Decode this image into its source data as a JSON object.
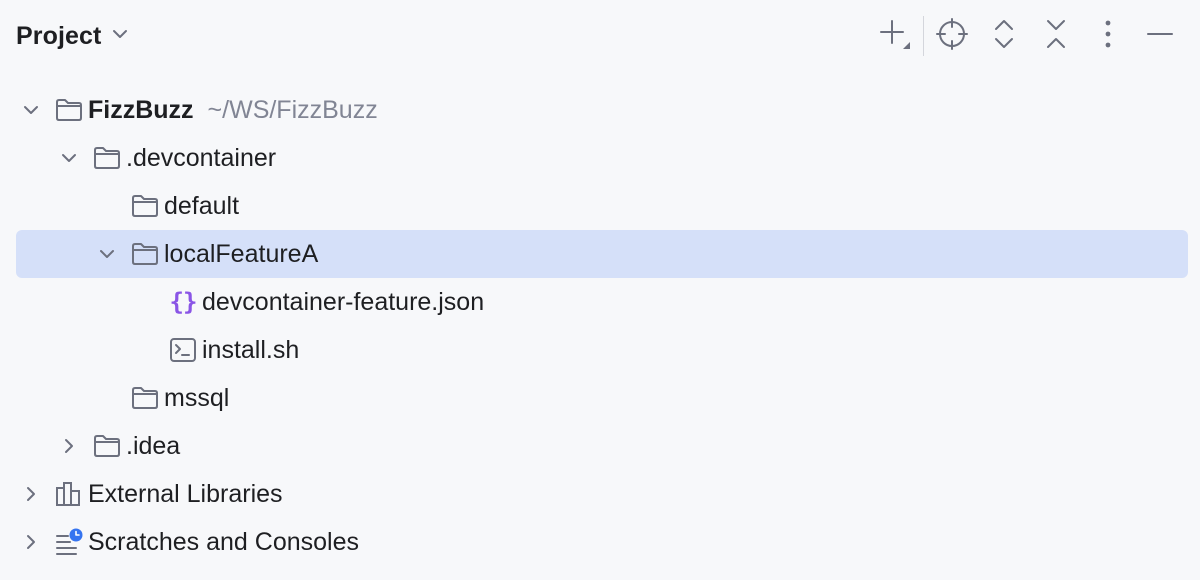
{
  "panel": {
    "title": "Project"
  },
  "toolbar": {
    "buttons": [
      {
        "name": "new-button",
        "icon": "plus-icon"
      },
      {
        "name": "locate-button",
        "icon": "crosshair-icon"
      },
      {
        "name": "expand-all-button",
        "icon": "expand-icon"
      },
      {
        "name": "collapse-all-button",
        "icon": "collapse-icon"
      },
      {
        "name": "options-button",
        "icon": "kebab-icon"
      },
      {
        "name": "hide-button",
        "icon": "minimize-icon"
      }
    ]
  },
  "tree": {
    "root": {
      "label": "FizzBuzz",
      "path": "~/WS/FizzBuzz",
      "expanded": true
    },
    "devcontainer": {
      "label": ".devcontainer",
      "expanded": true
    },
    "default": {
      "label": "default"
    },
    "localFeatureA": {
      "label": "localFeatureA",
      "expanded": true,
      "selected": true
    },
    "feature_json": {
      "label": "devcontainer-feature.json",
      "icon": "json-icon",
      "glyph": "{}"
    },
    "install_sh": {
      "label": "install.sh",
      "icon": "terminal-file-icon"
    },
    "mssql": {
      "label": "mssql"
    },
    "idea": {
      "label": ".idea",
      "expanded": false
    },
    "external_libraries": {
      "label": "External Libraries",
      "expanded": false,
      "icon": "library-icon"
    },
    "scratches": {
      "label": "Scratches and Consoles",
      "expanded": false,
      "icon": "scratches-icon"
    }
  },
  "colors": {
    "background": "#f7f8fa",
    "selection": "#d5e0f9",
    "text": "#1e1f22",
    "path_text": "#818594",
    "icon_stroke": "#6c707e",
    "json_accent": "#8a55e6",
    "clock_accent": "#3574f0"
  }
}
